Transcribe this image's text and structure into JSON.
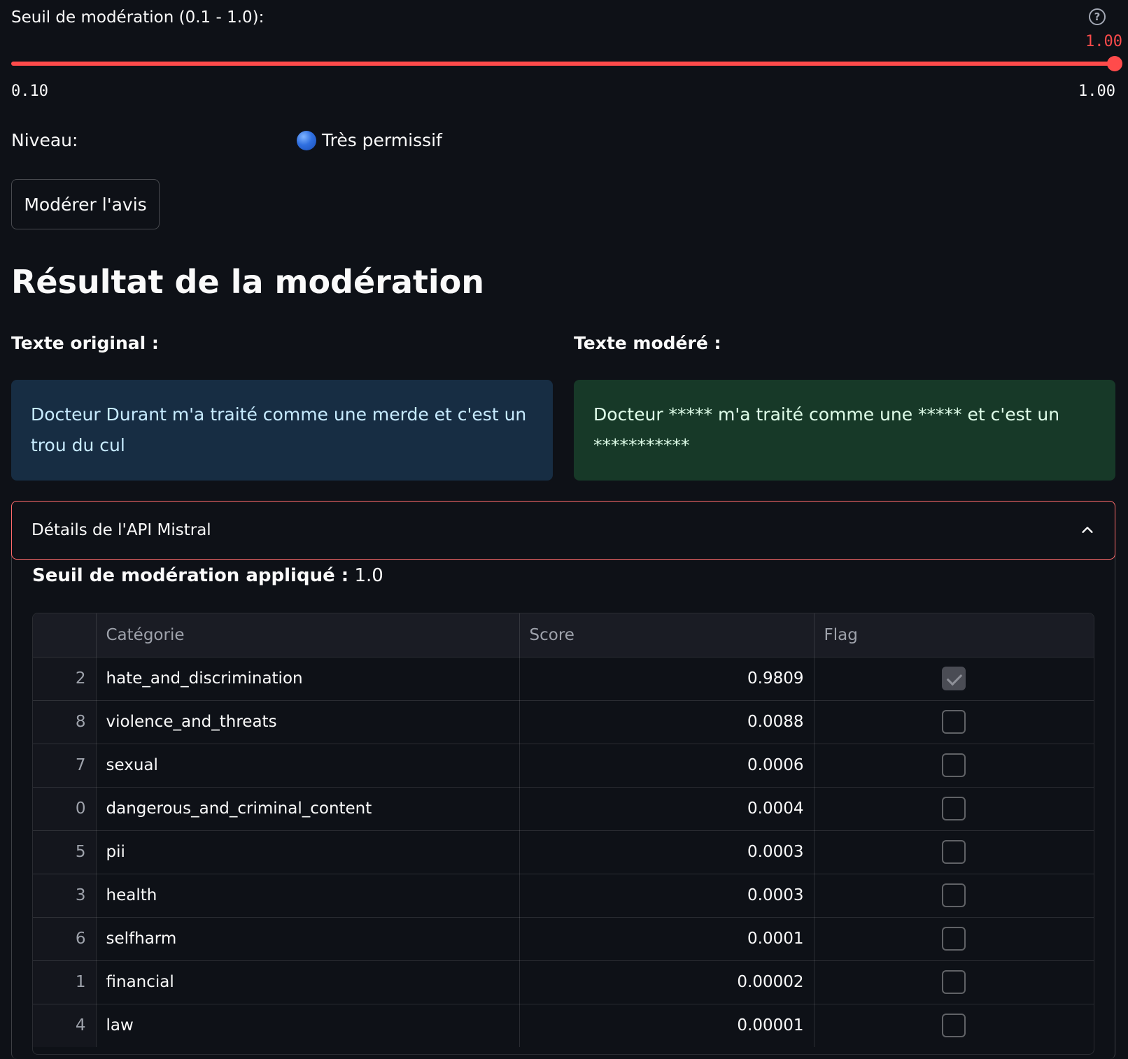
{
  "slider": {
    "label": "Seuil de modération (0.1 - 1.0):",
    "value": "1.00",
    "min": "0.10",
    "max": "1.00",
    "help_icon": "question-circle-icon",
    "accent_color": "#ff4b4b"
  },
  "niveau": {
    "label": "Niveau:",
    "value": "Très permissif",
    "indicator_icon": "blue-circle-icon"
  },
  "button": {
    "label": "Modérer l'avis"
  },
  "result": {
    "title": "Résultat de la modération",
    "original_label": "Texte original :",
    "original_text": "Docteur Durant m'a traité comme une merde et c'est un trou du cul",
    "moderated_label": "Texte modéré :",
    "moderated_text": "Docteur ***** m'a traité comme une ***** et c'est un ***********"
  },
  "expander": {
    "title": "Détails de l'API Mistral",
    "chevron_icon": "chevron-up-icon",
    "threshold_label": "Seuil de modération appliqué :",
    "threshold_value": "1.0"
  },
  "table": {
    "columns": [
      "Catégorie",
      "Score",
      "Flag"
    ],
    "rows": [
      {
        "index": "2",
        "category": "hate_and_discrimination",
        "score": "0.9809",
        "flag": true
      },
      {
        "index": "8",
        "category": "violence_and_threats",
        "score": "0.0088",
        "flag": false
      },
      {
        "index": "7",
        "category": "sexual",
        "score": "0.0006",
        "flag": false
      },
      {
        "index": "0",
        "category": "dangerous_and_criminal_content",
        "score": "0.0004",
        "flag": false
      },
      {
        "index": "5",
        "category": "pii",
        "score": "0.0003",
        "flag": false
      },
      {
        "index": "3",
        "category": "health",
        "score": "0.0003",
        "flag": false
      },
      {
        "index": "6",
        "category": "selfharm",
        "score": "0.0001",
        "flag": false
      },
      {
        "index": "1",
        "category": "financial",
        "score": "0.00002",
        "flag": false
      },
      {
        "index": "4",
        "category": "law",
        "score": "0.00001",
        "flag": false
      }
    ]
  }
}
